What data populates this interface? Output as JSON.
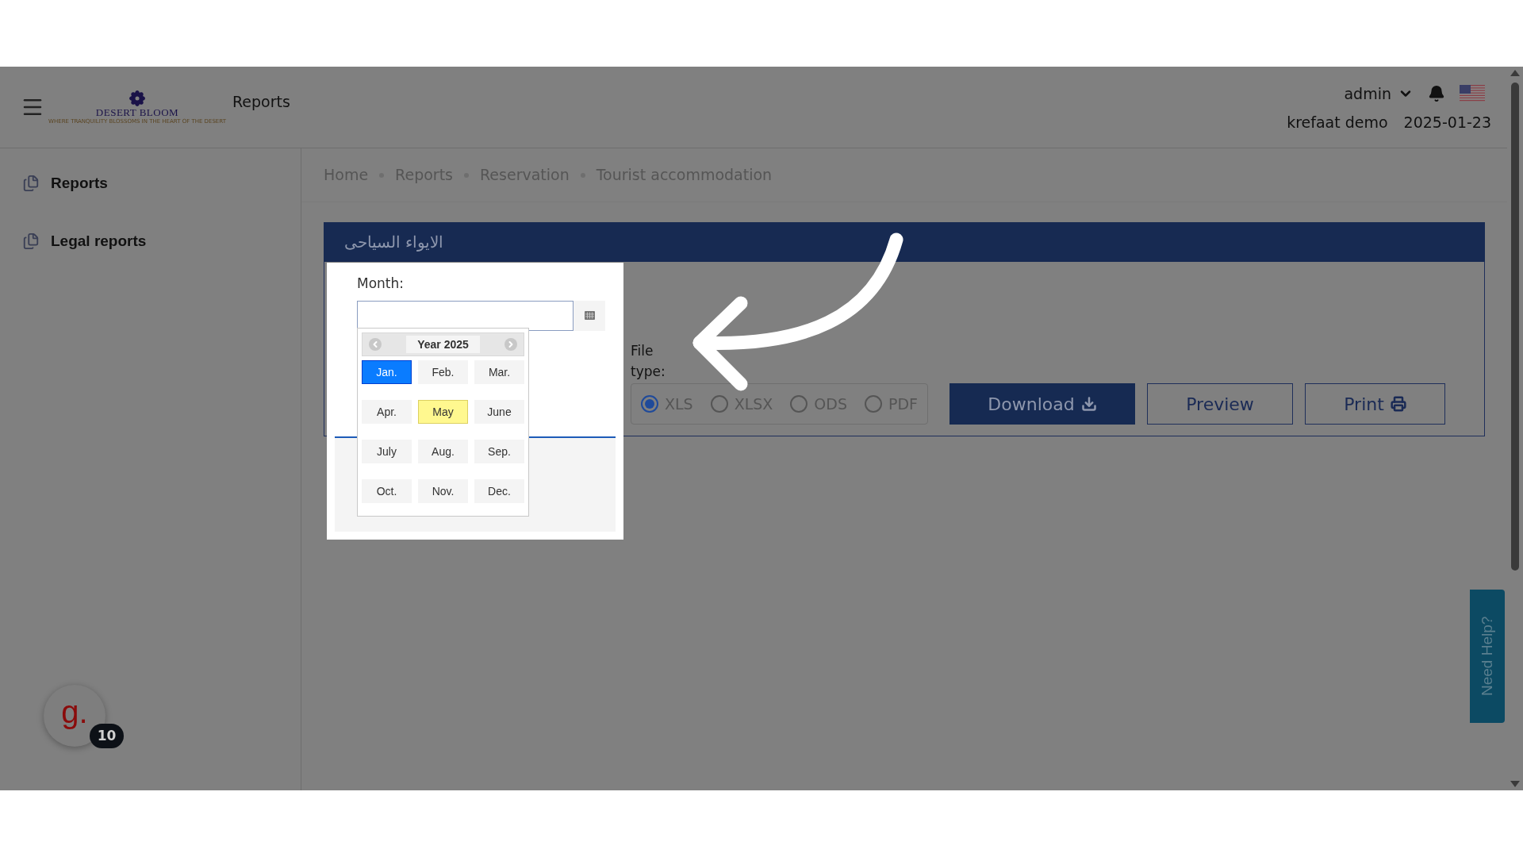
{
  "header": {
    "logo_text": "DESERT BLOOM",
    "logo_tagline": "WHERE TRANQUILITY BLOSSOMS IN THE HEART OF THE DESERT",
    "title": "Reports",
    "user": "admin",
    "company": "krefaat demo",
    "date": "2025-01-23"
  },
  "sidebar": {
    "items": [
      {
        "label": "Reports"
      },
      {
        "label": "Legal reports"
      }
    ]
  },
  "breadcrumb": [
    "Home",
    "Reports",
    "Reservation",
    "Tourist accommodation"
  ],
  "panel": {
    "title": "الايواء السياحى"
  },
  "month_field": {
    "label": "Month:"
  },
  "month_picker": {
    "year": "Year 2025",
    "months": [
      {
        "label": "Jan.",
        "selected": true,
        "current": false
      },
      {
        "label": "Feb.",
        "selected": false,
        "current": false
      },
      {
        "label": "Mar.",
        "selected": false,
        "current": false
      },
      {
        "label": "Apr.",
        "selected": false,
        "current": false
      },
      {
        "label": "May",
        "selected": false,
        "current": true
      },
      {
        "label": "June",
        "selected": false,
        "current": false
      },
      {
        "label": "July",
        "selected": false,
        "current": false
      },
      {
        "label": "Aug.",
        "selected": false,
        "current": false
      },
      {
        "label": "Sep.",
        "selected": false,
        "current": false
      },
      {
        "label": "Oct.",
        "selected": false,
        "current": false
      },
      {
        "label": "Nov.",
        "selected": false,
        "current": false
      },
      {
        "label": "Dec.",
        "selected": false,
        "current": false
      }
    ]
  },
  "file_type": {
    "label": "File type:",
    "options": [
      {
        "label": "XLS",
        "selected": true
      },
      {
        "label": "XLSX",
        "selected": false
      },
      {
        "label": "ODS",
        "selected": false
      },
      {
        "label": "PDF",
        "selected": false
      }
    ]
  },
  "buttons": [
    {
      "label": "Download",
      "kind": "primary"
    },
    {
      "label": "Preview",
      "kind": "outline"
    },
    {
      "label": "Print",
      "kind": "outline"
    }
  ],
  "help_tab": "Need Help?",
  "chat_widget": {
    "logo": "g.",
    "badge": "10"
  }
}
